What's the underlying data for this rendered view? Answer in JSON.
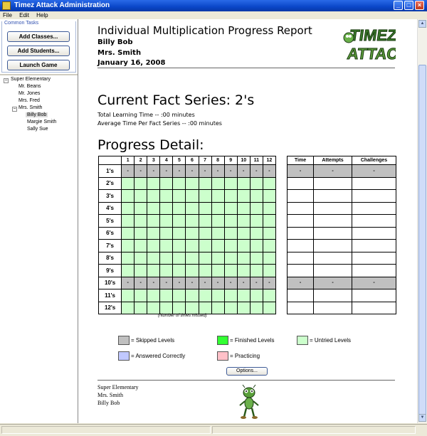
{
  "window": {
    "title": "Timez Attack Administration"
  },
  "menu": [
    "File",
    "Edit",
    "Help"
  ],
  "sidebar": {
    "tasks_header": "Common Tasks",
    "buttons": [
      "Add Classes...",
      "Add Students...",
      "Launch Game"
    ],
    "tree": {
      "school": "Super Elementary",
      "teachers": [
        "Mr. Beans",
        "Mr. Jones",
        "Mrs. Fred",
        "Mrs. Smith"
      ],
      "students": [
        "Billy Bob",
        "Margie Smith",
        "Sally Sue"
      ]
    }
  },
  "report": {
    "title": "Individual Multiplication Progress Report",
    "student": "Billy Bob",
    "teacher": "Mrs. Smith",
    "date": "January 16, 2008",
    "logo_text": "TIMEZ ATTACK",
    "current_series": "Current Fact Series: 2's",
    "total_time": "Total Learning Time -- :00 minutes",
    "avg_time": "Average Time Per Fact Series -- :00 minutes",
    "progress_title": "Progress Detail:",
    "columns": [
      "1",
      "2",
      "3",
      "4",
      "5",
      "6",
      "7",
      "8",
      "9",
      "10",
      "11",
      "12"
    ],
    "rows": [
      "1's",
      "2's",
      "3's",
      "4's",
      "5's",
      "6's",
      "7's",
      "8's",
      "9's",
      "10's",
      "11's",
      "12's"
    ],
    "skipped_rows": [
      "1's",
      "10's"
    ],
    "skipped_mark": "-",
    "side_columns": [
      "Time",
      "Attempts",
      "Challenges"
    ],
    "missed_note": "(Number of times missed)",
    "legend": {
      "skipped": "= Skipped Levels",
      "finished": "= Finished Levels",
      "untried": "= Untried Levels",
      "answered": "= Answered Correctly",
      "practicing": "= Practicing"
    },
    "options_button": "Options...",
    "footer": [
      "Super Elementary",
      "Mrs. Smith",
      "Billy Bob"
    ]
  },
  "colors": {
    "skipped": "#c0c0c0",
    "finished": "#33ff33",
    "untried": "#ccffcc",
    "answered": "#c0c8ff",
    "practicing": "#ffc0c8"
  }
}
